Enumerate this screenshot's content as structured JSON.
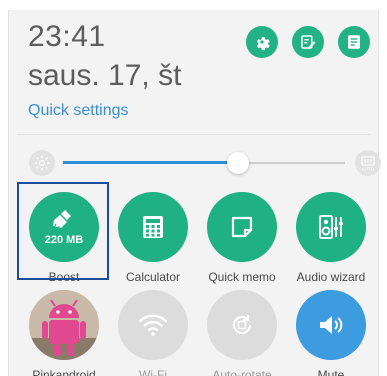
{
  "header": {
    "time": "23:41",
    "date": "saus. 17, št",
    "quick_settings_label": "Quick settings",
    "buttons": [
      {
        "name": "settings",
        "icon": "gear-icon"
      },
      {
        "name": "edit",
        "icon": "edit-icon"
      },
      {
        "name": "notes",
        "icon": "memo-icon"
      }
    ]
  },
  "brightness": {
    "low_icon": "brightness-low-icon",
    "auto_icon": "brightness-auto-icon",
    "auto_label": "AUTO",
    "level": 0.62
  },
  "tiles_row1": [
    {
      "label": "Boost",
      "value": "220 MB",
      "icon": "broom-icon",
      "state": "on"
    },
    {
      "label": "Calculator",
      "icon": "calculator-icon",
      "state": "on"
    },
    {
      "label": "Quick memo",
      "icon": "memo-note-icon",
      "state": "on"
    },
    {
      "label": "Audio wizard",
      "icon": "audio-wizard-icon",
      "state": "on"
    }
  ],
  "tiles_row2": [
    {
      "label": "Pinkandroid",
      "icon": "pink-android-avatar",
      "state": "on"
    },
    {
      "label": "Wi-Fi",
      "icon": "wifi-icon",
      "state": "off"
    },
    {
      "label": "Auto-rotate",
      "icon": "auto-rotate-icon",
      "state": "off"
    },
    {
      "label": "Mute",
      "icon": "mute-icon",
      "state": "on"
    }
  ],
  "colors": {
    "accent_green": "#1fb181",
    "accent_blue": "#3d9be0",
    "link_blue": "#3a8fd0",
    "inactive_grey": "#dcdcdc",
    "highlight_border": "#1b4d9c"
  }
}
